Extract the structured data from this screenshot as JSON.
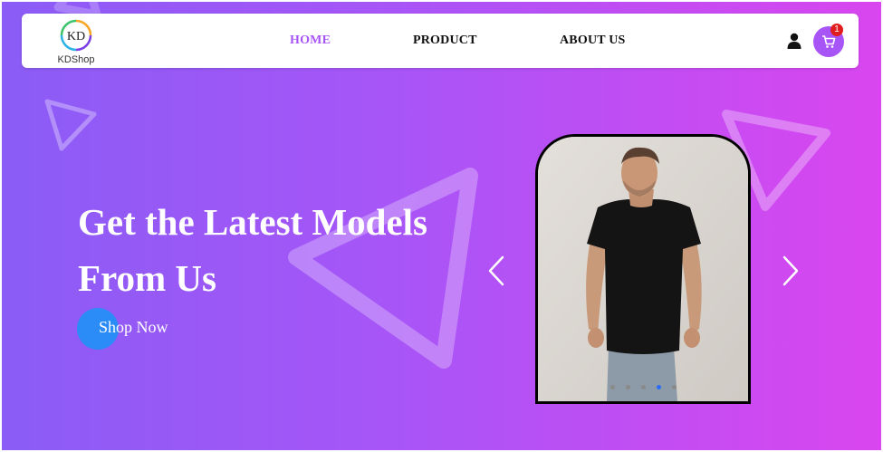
{
  "brand": {
    "logo_mark": "KD",
    "name": "KDShop"
  },
  "nav": {
    "items": [
      {
        "label": "HOME",
        "active": true
      },
      {
        "label": "PRODUCT",
        "active": false
      },
      {
        "label": "ABOUT US",
        "active": false
      }
    ],
    "user_icon": "user-icon",
    "cart_icon": "cart-icon",
    "cart_count": "1"
  },
  "hero": {
    "headline_line1": "Get the Latest Models",
    "headline_line2": "From Us",
    "cta_label": "Shop Now"
  },
  "carousel": {
    "prev_icon": "chevron-left-icon",
    "next_icon": "chevron-right-icon",
    "slide_image": "man-in-black-tshirt-photo",
    "slide_count": 5,
    "active_slide": 4
  },
  "colors": {
    "gradient_start": "#8b5cf6",
    "gradient_end": "#d946ef",
    "accent": "#a855f7",
    "cta": "#2b8cf7",
    "badge": "#e11d1d"
  }
}
